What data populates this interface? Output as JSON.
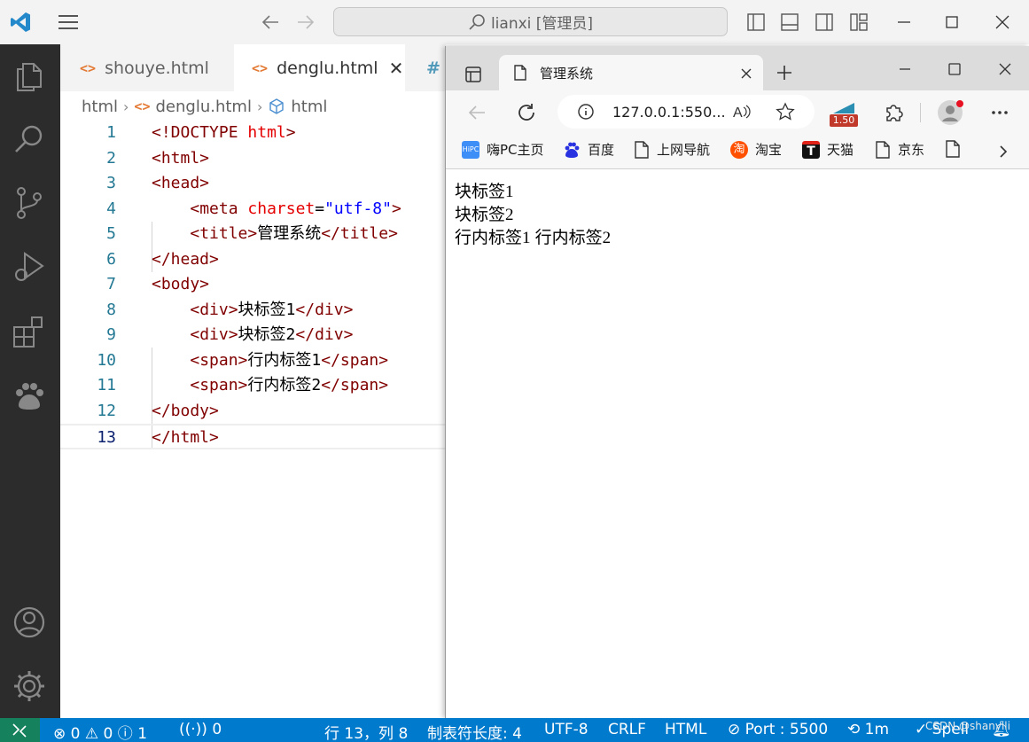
{
  "vscode": {
    "command_center": "lianxi [管理员]",
    "tabs": [
      {
        "label": "shouye.html",
        "icon": "<>"
      },
      {
        "label": "denglu.html",
        "icon": "<>"
      },
      {
        "label": "#"
      }
    ],
    "breadcrumb": [
      "html",
      "denglu.html",
      "html"
    ],
    "code": {
      "line_numbers": [
        "1",
        "2",
        "3",
        "4",
        "5",
        "6",
        "7",
        "8",
        "9",
        "10",
        "11",
        "12",
        "13"
      ],
      "current_line": "13"
    },
    "status_bar": {
      "problems": "0",
      "warnings": "0",
      "info": "1",
      "ports": "0",
      "position": "行 13，列 8",
      "tab_size": "制表符长度: 4",
      "encoding": "UTF-8",
      "eol": "CRLF",
      "language": "HTML",
      "port": "Port : 5500",
      "time": "1m",
      "spell": "Spell"
    }
  },
  "browser": {
    "tab_title": "管理系统",
    "url": "127.0.0.1:550...",
    "extension_badge": "1.50",
    "favorites": [
      "嗨PC主页",
      "百度",
      "上网导航",
      "淘宝",
      "天猫",
      "京东"
    ],
    "content": {
      "divs": [
        "块标签1",
        "块标签2"
      ],
      "spans": [
        "行内标签1",
        "行内标签2"
      ]
    }
  },
  "watermark": "CSDN @shanyili",
  "colors": {
    "status_bar": "#007acc",
    "remote_indicator": "#16825d",
    "activity_bar": "#2c2c2c",
    "tag": "#800000",
    "attribute": "#e50000",
    "string": "#0000ff"
  }
}
